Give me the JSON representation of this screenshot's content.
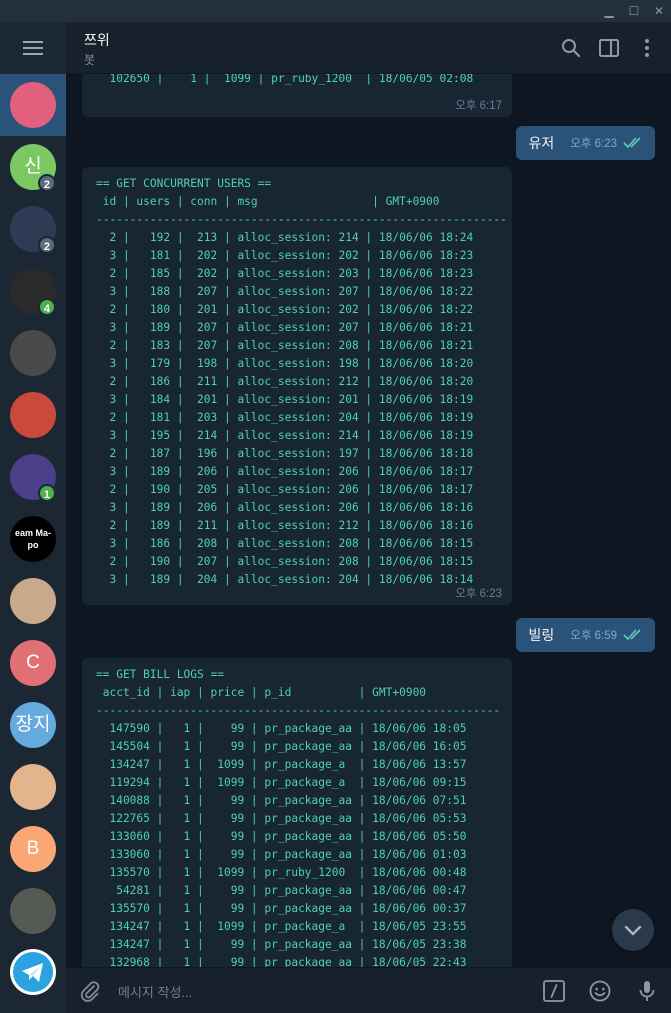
{
  "window": {
    "minimize": "▁",
    "maximize": "☐",
    "close": "✕"
  },
  "sidebar": {
    "items": [
      {
        "name": "chat-1",
        "avatar_text": "",
        "avatar_color": "#e0607e",
        "badge": ""
      },
      {
        "name": "chat-2",
        "avatar_text": "신",
        "avatar_color": "#7bc862",
        "badge": "2"
      },
      {
        "name": "chat-3",
        "avatar_text": "",
        "avatar_color": "#2d3b55",
        "badge": "2"
      },
      {
        "name": "chat-4",
        "avatar_text": "",
        "avatar_color": "#2a2a2a",
        "badge": "4"
      },
      {
        "name": "chat-5",
        "avatar_text": "",
        "avatar_color": "#4a4a4a",
        "badge": ""
      },
      {
        "name": "chat-6",
        "avatar_text": "",
        "avatar_color": "#c94a3c",
        "badge": ""
      },
      {
        "name": "chat-7",
        "avatar_text": "",
        "avatar_color": "#4b3f8a",
        "badge": "1"
      },
      {
        "name": "chat-8",
        "avatar_text": "eam Ma-po",
        "avatar_color": "#000000",
        "badge": ""
      },
      {
        "name": "chat-9",
        "avatar_text": "",
        "avatar_color": "#c9a98c",
        "badge": ""
      },
      {
        "name": "chat-10",
        "avatar_text": "C",
        "avatar_color": "#e17076",
        "badge": ""
      },
      {
        "name": "chat-11",
        "avatar_text": "장지",
        "avatar_color": "#65aadd",
        "badge": ""
      },
      {
        "name": "chat-12",
        "avatar_text": "",
        "avatar_color": "#e4b48c",
        "badge": ""
      },
      {
        "name": "chat-13",
        "avatar_text": "B",
        "avatar_color": "#faa774",
        "badge": ""
      },
      {
        "name": "chat-14",
        "avatar_text": "",
        "avatar_color": "#555a52",
        "badge": ""
      }
    ]
  },
  "header": {
    "title": "쯔위",
    "status": "봇"
  },
  "messages": {
    "first": {
      "text": "  102650 |    1 |  1099 | pr_ruby_1200  | 18/06/05 02:08",
      "time": "오후 6:17"
    },
    "out1": {
      "text": "유저",
      "time": "오후 6:23"
    },
    "users": {
      "text": "== GET CONCURRENT USERS ==\n id | users | conn | msg                 | GMT+0900\n-------------------------------------------------------------\n  2 |   192 |  213 | alloc_session: 214 | 18/06/06 18:24\n  3 |   181 |  202 | alloc_session: 202 | 18/06/06 18:23\n  2 |   185 |  202 | alloc_session: 203 | 18/06/06 18:23\n  3 |   188 |  207 | alloc_session: 207 | 18/06/06 18:22\n  2 |   180 |  201 | alloc_session: 202 | 18/06/06 18:22\n  3 |   189 |  207 | alloc_session: 207 | 18/06/06 18:21\n  2 |   183 |  207 | alloc_session: 208 | 18/06/06 18:21\n  3 |   179 |  198 | alloc_session: 198 | 18/06/06 18:20\n  2 |   186 |  211 | alloc_session: 212 | 18/06/06 18:20\n  3 |   184 |  201 | alloc_session: 201 | 18/06/06 18:19\n  2 |   181 |  203 | alloc_session: 204 | 18/06/06 18:19\n  3 |   195 |  214 | alloc_session: 214 | 18/06/06 18:19\n  2 |   187 |  196 | alloc_session: 197 | 18/06/06 18:18\n  3 |   189 |  206 | alloc_session: 206 | 18/06/06 18:17\n  2 |   190 |  205 | alloc_session: 206 | 18/06/06 18:17\n  3 |   189 |  206 | alloc_session: 206 | 18/06/06 18:16\n  2 |   189 |  211 | alloc_session: 212 | 18/06/06 18:16\n  3 |   186 |  208 | alloc_session: 208 | 18/06/06 18:15\n  2 |   190 |  207 | alloc_session: 208 | 18/06/06 18:15\n  3 |   189 |  204 | alloc_session: 204 | 18/06/06 18:14",
      "time": "오후 6:23"
    },
    "out2": {
      "text": "빌링",
      "time": "오후 6:59"
    },
    "bills": {
      "text": "== GET BILL LOGS ==\n acct_id | iap | price | p_id          | GMT+0900\n------------------------------------------------------------\n  147590 |   1 |    99 | pr_package_aa | 18/06/06 18:05\n  145504 |   1 |    99 | pr_package_aa | 18/06/06 16:05\n  134247 |   1 |  1099 | pr_package_a  | 18/06/06 13:57\n  119294 |   1 |  1099 | pr_package_a  | 18/06/06 09:15\n  140088 |   1 |    99 | pr_package_aa | 18/06/06 07:51\n  122765 |   1 |    99 | pr_package_aa | 18/06/06 05:53\n  133060 |   1 |    99 | pr_package_aa | 18/06/06 05:50\n  133060 |   1 |    99 | pr_package_aa | 18/06/06 01:03\n  135570 |   1 |  1099 | pr_ruby_1200  | 18/06/06 00:48\n   54281 |   1 |    99 | pr_package_aa | 18/06/06 00:47\n  135570 |   1 |    99 | pr_package_aa | 18/06/06 00:37\n  134247 |   1 |  1099 | pr_package_a  | 18/06/05 23:55\n  134247 |   1 |    99 | pr_package_aa | 18/06/05 23:38\n  132968 |   1 |    99 | pr_package_aa | 18/06/05 22:43"
    }
  },
  "input": {
    "placeholder": "메시지 작성..."
  }
}
